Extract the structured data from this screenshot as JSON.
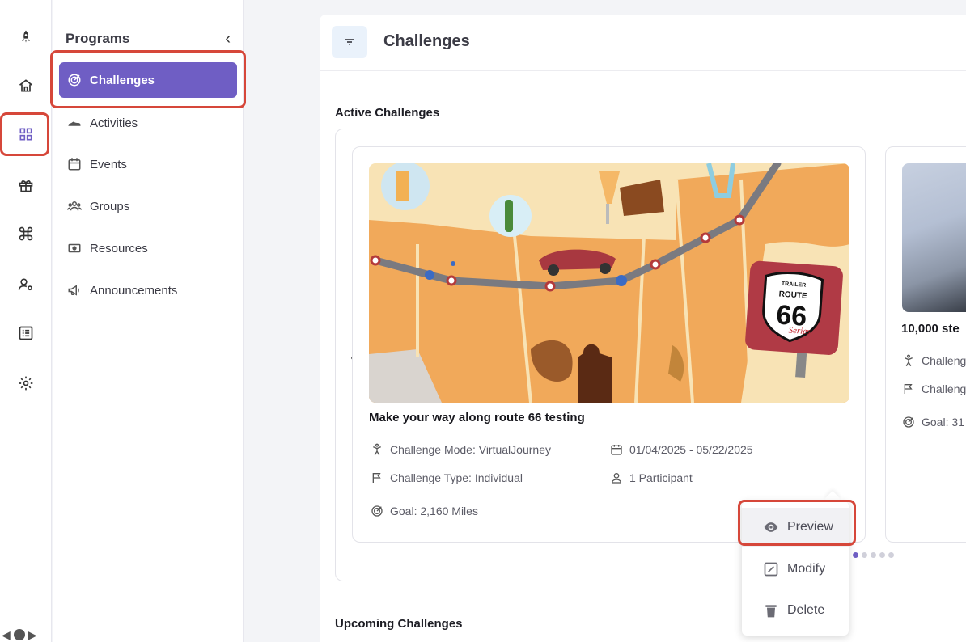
{
  "rail": {
    "icons": [
      "rocket-icon",
      "home-icon",
      "grid-icon",
      "gift-icon",
      "command-icon",
      "user-settings-icon",
      "list-icon",
      "gear-icon"
    ],
    "active": "grid-icon"
  },
  "nav": {
    "title": "Programs",
    "items": [
      {
        "label": "Challenges",
        "icon": "target-icon",
        "active": true
      },
      {
        "label": "Activities",
        "icon": "sneaker-icon"
      },
      {
        "label": "Events",
        "icon": "calendar-icon"
      },
      {
        "label": "Groups",
        "icon": "group-icon"
      },
      {
        "label": "Resources",
        "icon": "money-icon"
      },
      {
        "label": "Announcements",
        "icon": "megaphone-icon"
      }
    ]
  },
  "header": {
    "title": "Challenges"
  },
  "sections": {
    "active": "Active Challenges",
    "upcoming": "Upcoming Challenges"
  },
  "cards": [
    {
      "title": "Make your way along route 66 testing",
      "mode": "Challenge Mode: VirtualJourney",
      "dates": "01/04/2025 - 05/22/2025",
      "type": "Challenge Type: Individual",
      "participants": "1 Participant",
      "goal": "Goal: 2,160 Miles",
      "sign_top": "TRAILER",
      "sign_route": "ROUTE",
      "sign_num": "66",
      "sign_series": "Series"
    },
    {
      "title": "10,000 ste",
      "mode": "Challeng",
      "type": "Challeng",
      "goal": "Goal: 31"
    }
  ],
  "pager": {
    "count": 5,
    "active": 0
  },
  "menu": {
    "preview": "Preview",
    "modify": "Modify",
    "delete": "Delete"
  },
  "colors": {
    "accent": "#6f5ec4",
    "highlight": "#d6473a"
  }
}
